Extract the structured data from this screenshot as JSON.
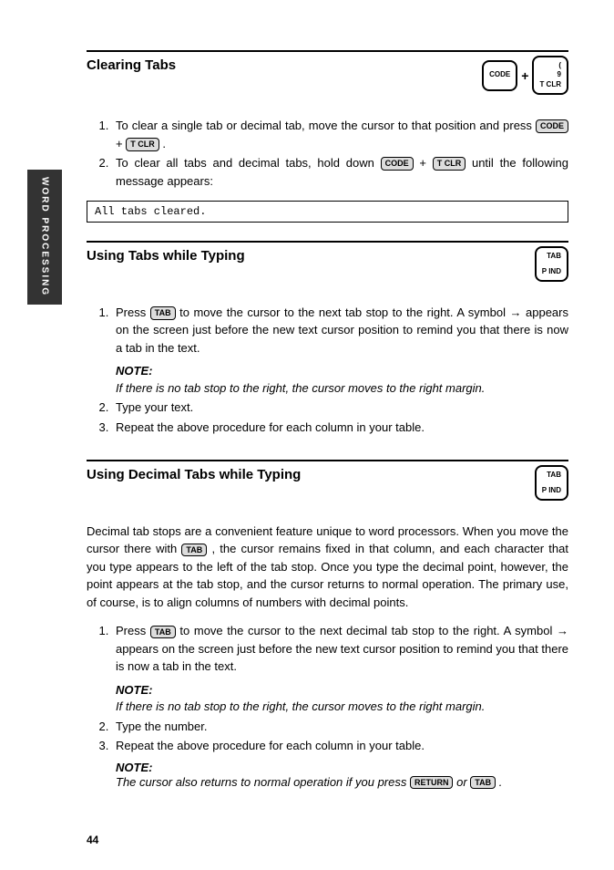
{
  "sideTab": "WORD PROCESSING",
  "section1": {
    "title": "Clearing Tabs",
    "key1": "CODE",
    "key2top": "(",
    "key2mid": "9",
    "key2bot": "T CLR",
    "step1a": "To clear a single tab or decimal tab, move the cursor to that position and press ",
    "step1k1": "CODE",
    "step1plus": " + ",
    "step1k2": "T CLR",
    "step1b": " .",
    "step2a": "To clear all tabs and decimal tabs, hold down ",
    "step2k1": "CODE",
    "step2plus": " + ",
    "step2k2": "T CLR",
    "step2b": " until the following message appears:",
    "msg": "All tabs cleared."
  },
  "section2": {
    "title": "Using Tabs while Typing",
    "keyTop": "TAB",
    "keyBot": "P IND",
    "step1a": "Press ",
    "step1k": "TAB",
    "step1b": " to move the cursor to the next tab stop to the right. A symbol ",
    "arrow": "→",
    "step1c": " appears on the screen just before the new text cursor position to remind you that there is now a tab in the text.",
    "noteLabel": "NOTE:",
    "noteText": "If there is no tab stop to the right, the cursor moves to the right margin.",
    "step2": "Type your text.",
    "step3": "Repeat the above procedure for each column in your table."
  },
  "section3": {
    "title": "Using Decimal Tabs while Typing",
    "keyTop": "TAB",
    "keyBot": "P IND",
    "paraA": "Decimal tab stops are a convenient feature unique to word processors. When you move the cursor there with ",
    "paraK": "TAB",
    "paraB": ", the cursor remains fixed in that column, and each character that you type appears to the left of the tab stop. Once you type the decimal point, however, the point appears at the tab stop, and the cursor returns to normal operation. The primary use, of course, is to align columns of numbers with decimal points.",
    "step1a": "Press ",
    "step1k": "TAB",
    "step1b": " to move the cursor to the next decimal tab stop to the right. A symbol ",
    "arrow": "→",
    "step1c": " appears on the screen just before the new text cursor position to remind you that there is now a tab in the text.",
    "note1Label": "NOTE:",
    "note1Text": "If there is no tab stop to the right, the cursor moves to the right margin.",
    "step2": "Type the number.",
    "step3": "Repeat the above procedure for each column in your table.",
    "note2Label": "NOTE:",
    "note2a": "The cursor also returns to normal operation if you press ",
    "note2k1": "RETURN",
    "note2mid": " or ",
    "note2k2": "TAB",
    "note2b": " ."
  },
  "pageNum": "44"
}
